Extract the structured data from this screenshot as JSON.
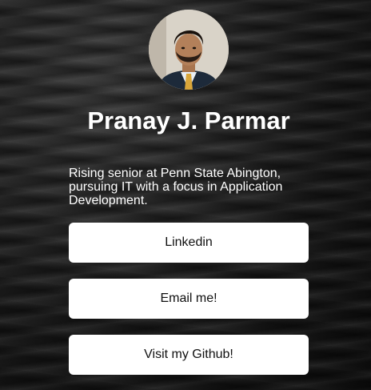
{
  "profile": {
    "name": "Pranay J. Parmar",
    "bio": "Rising senior at Penn State Abington, pursuing IT with a focus in Application Development."
  },
  "links": [
    {
      "label": "Linkedin"
    },
    {
      "label": "Email me!"
    },
    {
      "label": "Visit my Github!"
    }
  ],
  "colors": {
    "background": "#1c1c1c",
    "button_bg": "#ffffff",
    "button_text": "#111111",
    "heading_text": "#ffffff"
  }
}
